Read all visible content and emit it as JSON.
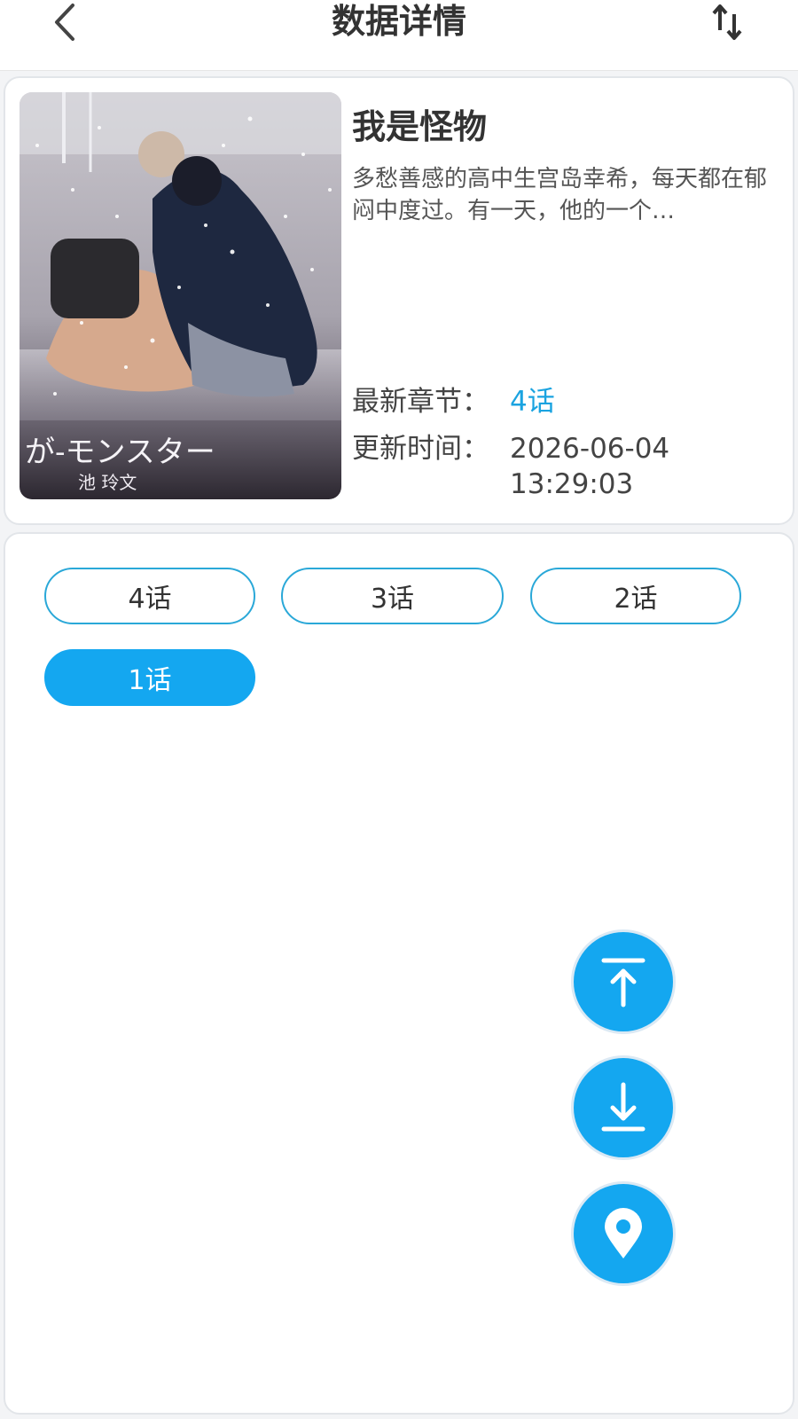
{
  "header": {
    "title": "数据详情",
    "back_icon": "chevron-left-icon",
    "sort_icon": "sort-arrows-icon"
  },
  "book": {
    "title": "我是怪物",
    "description": "多愁善感的高中生宫岛幸希，每天都在郁闷中度过。有一天，他的一个…",
    "cover_text": "が-モンスター",
    "cover_author": "池 玲文",
    "latest_label": "最新章节：",
    "latest_value": "4话",
    "update_label": "更新时间：",
    "update_value": "2026-06-04 13:29:03"
  },
  "chapters": [
    {
      "label": "4话",
      "active": false
    },
    {
      "label": "3话",
      "active": false
    },
    {
      "label": "2话",
      "active": false
    },
    {
      "label": "1话",
      "active": true
    }
  ],
  "fabs": [
    "scroll-top-icon",
    "scroll-bottom-icon",
    "location-pin-icon"
  ],
  "colors": {
    "accent": "#14a7f0",
    "chapter_border": "#2aa8d8",
    "latest_link": "#1aa3e0"
  }
}
